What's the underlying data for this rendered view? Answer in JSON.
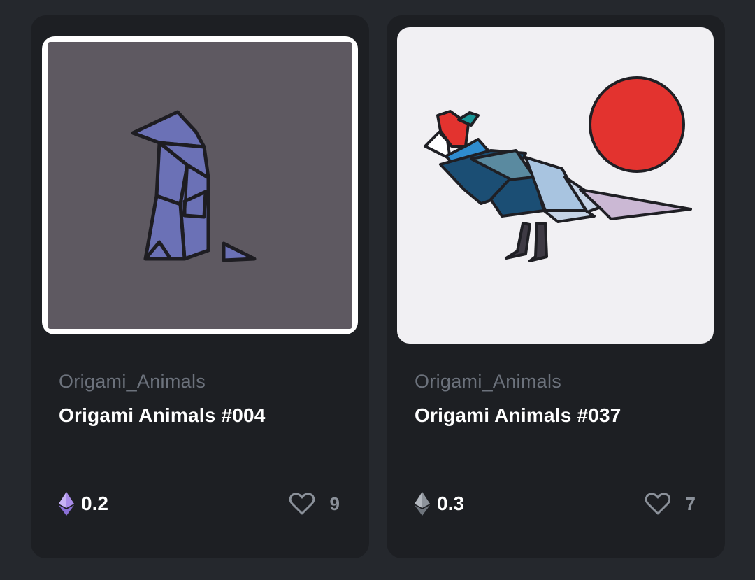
{
  "cards": [
    {
      "collection": "Origami_Animals",
      "title": "Origami Animals #004",
      "price": "0.2",
      "likes": "9",
      "image_alt": "origami penguin",
      "eth_icon_color": "#a98ce8"
    },
    {
      "collection": "Origami_Animals",
      "title": "Origami Animals #037",
      "price": "0.3",
      "likes": "7",
      "image_alt": "origami pheasant with red sun",
      "eth_icon_color": "#9aa0a8"
    }
  ],
  "icons": {
    "price": "ethereum-icon",
    "likes": "heart-icon"
  },
  "colors": {
    "page_bg": "#25282d",
    "card_bg": "#1d1f23",
    "collection_text": "#6c727c",
    "title_text": "#ffffff"
  }
}
